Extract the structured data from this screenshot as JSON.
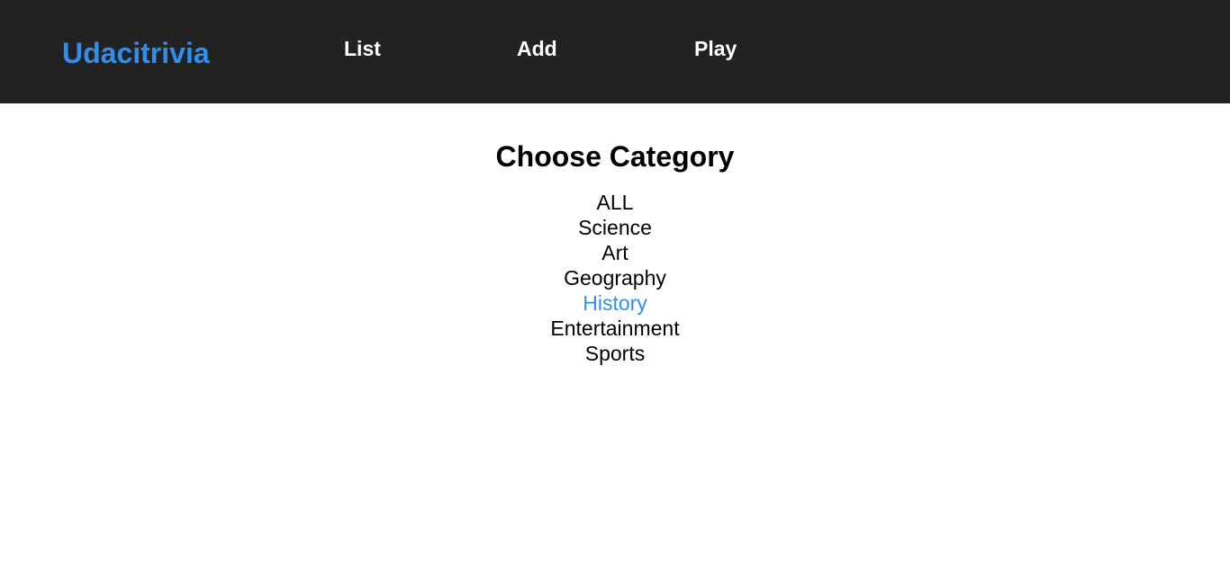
{
  "navbar": {
    "brand": "Udacitrivia",
    "links": [
      "List",
      "Add",
      "Play"
    ]
  },
  "main": {
    "title": "Choose Category",
    "categories": [
      "ALL",
      "Science",
      "Art",
      "Geography",
      "History",
      "Entertainment",
      "Sports"
    ],
    "highlighted_category": "History"
  },
  "colors": {
    "navbar_bg": "#222222",
    "accent": "#2e8ff0",
    "nav_text": "#ffffff",
    "body_text": "#000000"
  }
}
